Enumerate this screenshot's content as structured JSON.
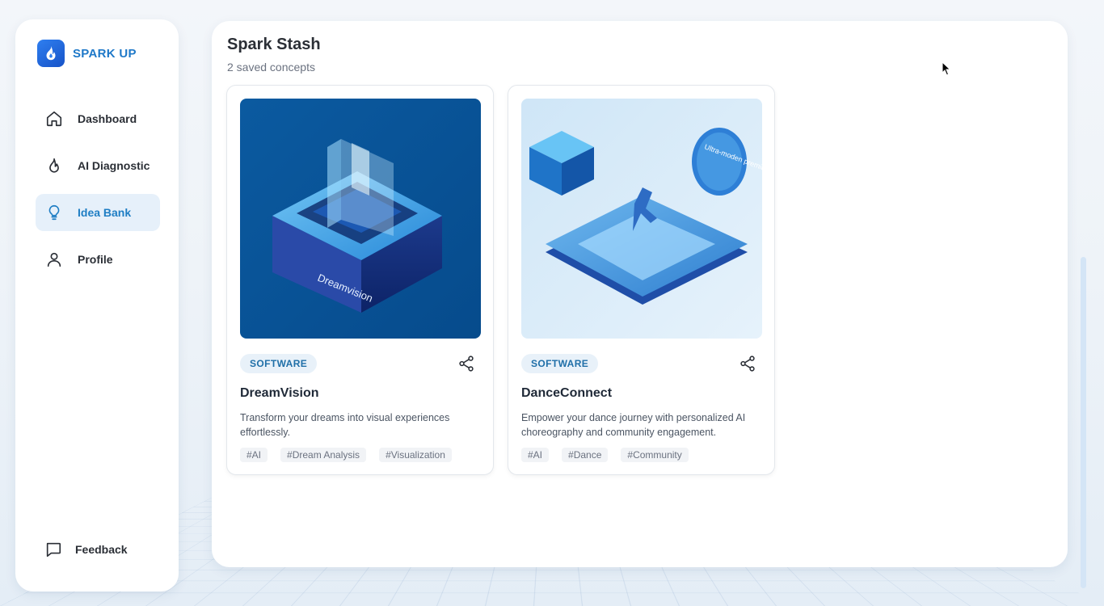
{
  "brand": {
    "name": "SPARK UP"
  },
  "nav": {
    "items": [
      {
        "label": "Dashboard",
        "icon": "home-icon",
        "active": false
      },
      {
        "label": "AI Diagnostic",
        "icon": "flame-icon",
        "active": false
      },
      {
        "label": "Idea Bank",
        "icon": "lightbulb-icon",
        "active": true
      },
      {
        "label": "Profile",
        "icon": "user-icon",
        "active": false
      }
    ],
    "feedback_label": "Feedback"
  },
  "main": {
    "title": "Spark Stash",
    "subtitle": "2 saved concepts"
  },
  "cards": [
    {
      "category": "SOFTWARE",
      "title": "DreamVision",
      "description": "Transform your dreams into visual experiences effortlessly.",
      "tags": [
        "#AI",
        "#Dream Analysis",
        "#Visualization"
      ],
      "image_label": "Dreamvision"
    },
    {
      "category": "SOFTWARE",
      "title": "DanceConnect",
      "description": "Empower your dance journey with personalized AI choreography and community engagement.",
      "tags": [
        "#AI",
        "#Dance",
        "#Community"
      ],
      "image_label": "Ultra-moden premium pisnipt"
    }
  ],
  "colors": {
    "accent": "#1f7ec4",
    "active_bg": "#e6f0fa",
    "badge_bg": "#e8f1f9"
  }
}
